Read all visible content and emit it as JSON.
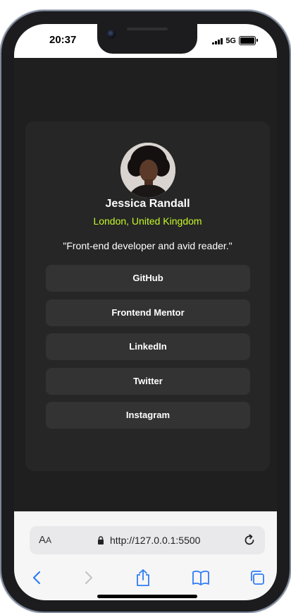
{
  "status_bar": {
    "time": "20:37",
    "network": "5G"
  },
  "profile": {
    "name": "Jessica Randall",
    "location": "London, United Kingdom",
    "bio": "\"Front-end developer and avid reader.\""
  },
  "links": [
    {
      "label": "GitHub"
    },
    {
      "label": "Frontend Mentor"
    },
    {
      "label": "LinkedIn"
    },
    {
      "label": "Twitter"
    },
    {
      "label": "Instagram"
    }
  ],
  "browser": {
    "reader_label_large": "A",
    "reader_label_small": "A",
    "url": "http://127.0.0.1:5500"
  },
  "colors": {
    "accent": "#c5f82a",
    "card": "#262626",
    "button": "#333333",
    "background": "#1f1f1f",
    "ios_blue": "#2f7cf6"
  },
  "icons": {
    "lock": "lock-icon",
    "reload": "reload-icon",
    "back": "chevron-left-icon",
    "forward": "chevron-right-icon",
    "share": "share-icon",
    "bookmarks": "book-icon",
    "tabs": "tabs-icon"
  }
}
